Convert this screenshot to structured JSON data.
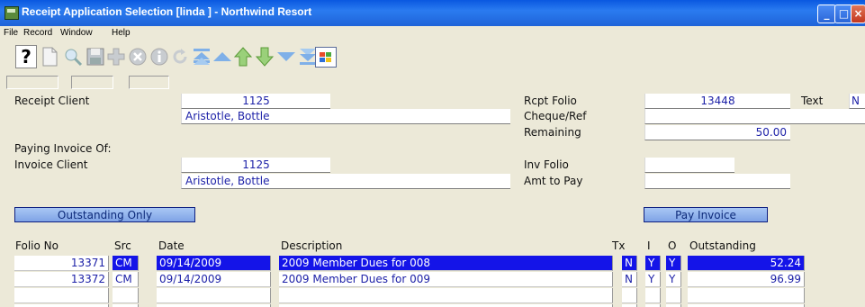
{
  "window": {
    "title": "Receipt Application Selection [linda   ] - Northwind Resort"
  },
  "menu": [
    "File",
    "Record",
    "Window",
    "Help"
  ],
  "toolbar": {
    "icons": [
      "help-icon",
      "new-record-icon",
      "search-icon",
      "save-icon",
      "add-icon",
      "delete-icon",
      "info-icon",
      "undo-icon",
      "first-record-icon",
      "previous-page-icon",
      "previous-record-icon",
      "next-record-icon",
      "next-page-icon",
      "last-record-icon",
      "windows-icon"
    ],
    "help_glyph": "?"
  },
  "receipt": {
    "client_label": "Receipt Client",
    "client_id": "1125",
    "client_name": "Aristotle, Bottle",
    "folio_label": "Rcpt Folio",
    "folio": "13448",
    "text_label": "Text",
    "text_value": "N",
    "cheque_label": "Cheque/Ref",
    "cheque": "",
    "remaining_label": "Remaining",
    "remaining": "50.00"
  },
  "invoice": {
    "paying_label": "Paying Invoice Of:",
    "client_label": "Invoice Client",
    "client_id": "1125",
    "client_name": "Aristotle, Bottle",
    "folio_label": "Inv Folio",
    "folio": "",
    "amt_label": "Amt to Pay",
    "amt": ""
  },
  "buttons": {
    "outstanding_only": "Outstanding Only",
    "pay_invoice": "Pay Invoice"
  },
  "table": {
    "headers": {
      "folio": "Folio No",
      "src": "Src",
      "date": "Date",
      "desc": "Description",
      "tx": "Tx",
      "i": "I",
      "o": "O",
      "outstanding": "Outstanding"
    },
    "rows": [
      {
        "folio": "13371",
        "src": "CM",
        "date": "09/14/2009",
        "desc": "2009 Member Dues for 008",
        "tx": "N",
        "i": "Y",
        "o": "Y",
        "outstanding": "52.24"
      },
      {
        "folio": "13372",
        "src": "CM",
        "date": "09/14/2009",
        "desc": "2009 Member Dues for 009",
        "tx": "N",
        "i": "Y",
        "o": "Y",
        "outstanding": "96.99"
      }
    ]
  }
}
